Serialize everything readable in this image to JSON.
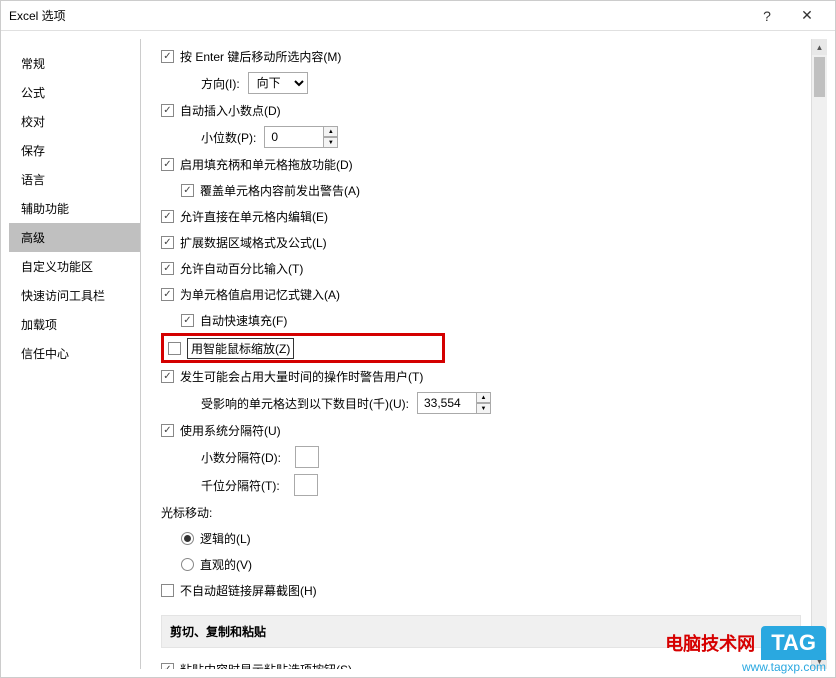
{
  "titlebar": {
    "title": "Excel 选项",
    "help": "?",
    "close": "✕"
  },
  "sidebar": {
    "items": [
      {
        "label": "常规"
      },
      {
        "label": "公式"
      },
      {
        "label": "校对"
      },
      {
        "label": "保存"
      },
      {
        "label": "语言"
      },
      {
        "label": "辅助功能"
      },
      {
        "label": "高级"
      },
      {
        "label": "自定义功能区"
      },
      {
        "label": "快速访问工具栏"
      },
      {
        "label": "加载项"
      },
      {
        "label": "信任中心"
      }
    ]
  },
  "main": {
    "opt_enter_move": "按 Enter 键后移动所选内容(M)",
    "direction_label": "方向(I):",
    "direction_value": "向下",
    "opt_auto_decimal": "自动插入小数点(D)",
    "decimals_label": "小位数(P):",
    "decimals_value": "0",
    "opt_fill_handle": "启用填充柄和单元格拖放功能(D)",
    "opt_overwrite_warn": "覆盖单元格内容前发出警告(A)",
    "opt_edit_direct": "允许直接在单元格内编辑(E)",
    "opt_extend_format": "扩展数据区域格式及公式(L)",
    "opt_auto_percent": "允许自动百分比输入(T)",
    "opt_autocomplete": "为单元格值启用记忆式键入(A)",
    "opt_flash_fill": "自动快速填充(F)",
    "opt_intellimouse": "用智能鼠标缩放(Z)",
    "opt_warn_long": "发生可能会占用大量时间的操作时警告用户(T)",
    "threshold_label": "受影响的单元格达到以下数目时(千)(U):",
    "threshold_value": "33,554",
    "opt_system_sep": "使用系统分隔符(U)",
    "decimal_sep_label": "小数分隔符(D):",
    "thousand_sep_label": "千位分隔符(T):",
    "cursor_move_label": "光标移动:",
    "radio_logical": "逻辑的(L)",
    "radio_visual": "直观的(V)",
    "opt_no_screenshot": "不自动超链接屏幕截图(H)",
    "section_cutcopy": "剪切、复制和粘贴",
    "opt_paste_button": "粘贴内容时显示粘贴选项按钮(S)"
  },
  "watermark": {
    "brand": "电脑技术网",
    "tag": "TAG",
    "url": "www.tagxp.com"
  }
}
